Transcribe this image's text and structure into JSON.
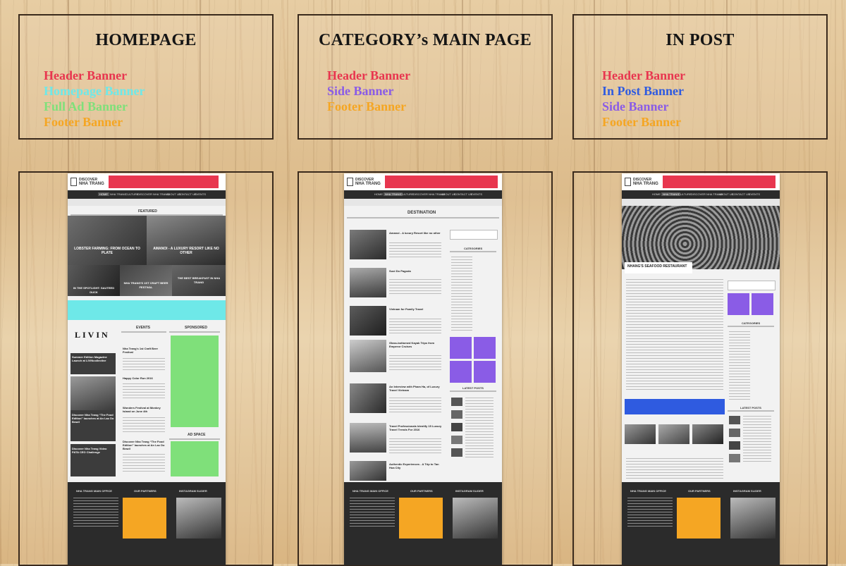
{
  "colors": {
    "header": "#e8364f",
    "homepage": "#6ee8e8",
    "full_ad": "#7fe07a",
    "footer": "#f5a623",
    "side": "#8a5ce6",
    "in_post": "#2f5be0"
  },
  "panels": [
    {
      "title": "HOMEPAGE",
      "items": [
        {
          "label": "Header Banner",
          "color": "#e8364f"
        },
        {
          "label": "Homepage Banner",
          "color": "#6ee8e8"
        },
        {
          "label": "Full Ad Banner",
          "color": "#7fe07a"
        },
        {
          "label": "Footer Banner",
          "color": "#f5a623"
        }
      ]
    },
    {
      "title": "CATEGORY’s MAIN PAGE",
      "items": [
        {
          "label": "Header Banner",
          "color": "#e8364f"
        },
        {
          "label": "Side Banner",
          "color": "#8a5ce6"
        },
        {
          "label": "Footer Banner",
          "color": "#f5a623"
        }
      ]
    },
    {
      "title": "IN POST",
      "items": [
        {
          "label": "Header Banner",
          "color": "#e8364f"
        },
        {
          "label": "In Post Banner",
          "color": "#2f5be0"
        },
        {
          "label": "Side Banner",
          "color": "#8a5ce6"
        },
        {
          "label": "Footer Banner",
          "color": "#f5a623"
        }
      ]
    }
  ],
  "site": {
    "logo_line1": "DISCOVER",
    "logo_line2": "NHA TRANG",
    "nav": [
      "HOME",
      "NHA TRANG",
      "CULTURE",
      "DISCOVER NHA TRANG",
      "ABOUT US",
      "CONTACT US",
      "EVENTS"
    ],
    "homepage": {
      "featured": "FEATURED",
      "feature_caps": [
        "LOBSTER FARMING: FROM OCEAN TO PLATE",
        "AMANOI - A LUXURY RESORT LIKE NO OTHER",
        "IN THE SPOTLIGHT: SAUTEED DUCK",
        "NHA TRANG'S 1ST CRAFT BEER FESTIVAL",
        "THE BEST BREAKFAST IN NHA TRANG"
      ],
      "livin": "LIVIN",
      "events": "EVENTS",
      "sponsored": "SPONSORED",
      "ad_space": "AD SPACE",
      "left_posts": [
        "Summer Edition Magazine Launch at LIVINcollective",
        "Discover Nha Trang “The Food Edition” launches at An Lac Do Brazil",
        "Discover Nha Trang Video PATA CEO Challenge"
      ],
      "event_posts": [
        "Nha Trang's 1st Craft Beer Festival",
        "Happy Color Run 2016",
        "Wonders Festival at Monkey Island on June 4th",
        "Discover Nha Trang “The Food Edition” launches at An Lac Do Brazil"
      ]
    },
    "category": {
      "title": "DESTINATION",
      "categories": "CATEGORIES",
      "latest": "LATEST POSTS",
      "posts": [
        "Amanoi - A luxury Resort like no other",
        "Suoi Do Pagoda",
        "Vietnam for Family Travel",
        "Glass-bottomed Kayak Trips from Emperor Cruises",
        "An Interview with Pham Ha, of Luxury Travel Vietnam",
        "Travel Professionals Identify 15 Luxury Travel Trends For 2016",
        "Authentic Experiences - A Trip to Tan Hoa City"
      ]
    },
    "post": {
      "title": "NHANG'S SEAFOOD RESTAURANT",
      "categories": "CATEGORIES",
      "latest": "LATEST POSTS"
    },
    "footer": {
      "office": "NHA TRANG MAIN OFFICE",
      "partners": "OUR PARTNERS",
      "instagram": "INSTAGRAM SLIDER"
    }
  }
}
